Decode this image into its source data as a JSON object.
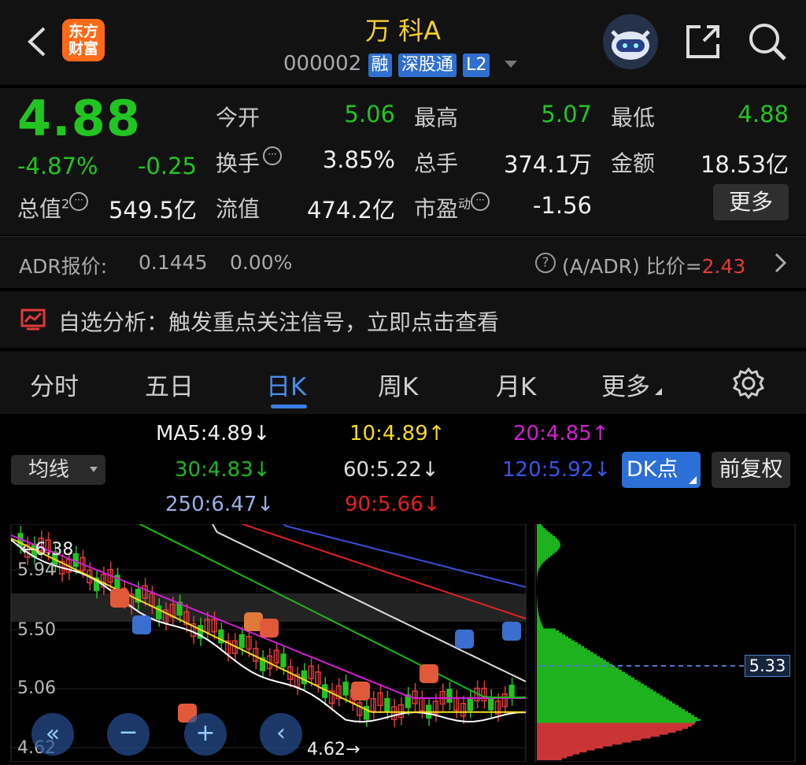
{
  "header": {
    "logo_top": "东方",
    "logo_bottom": "财富",
    "title": "万 科A",
    "code": "000002",
    "tags": [
      "融",
      "深股通",
      "L2"
    ]
  },
  "quote": {
    "price": "4.88",
    "change_pct": "-4.87%",
    "change": "-0.25",
    "total_value_label": "总值",
    "total_value_sup": "2",
    "total_value": "549.5亿",
    "open_label": "今开",
    "open": "5.06",
    "high_label": "最高",
    "high": "5.07",
    "low_label": "最低",
    "low": "4.88",
    "turnover_label": "换手",
    "turnover": "3.85%",
    "volume_label": "总手",
    "volume": "374.1万",
    "amount_label": "金额",
    "amount": "18.53亿",
    "float_label": "流值",
    "float_value": "474.2亿",
    "pe_label": "市盈",
    "pe_sup": "动",
    "pe": "-1.56",
    "more_label": "更多"
  },
  "adr": {
    "label": "ADR报价:",
    "price": "0.1445",
    "pct": "0.00%",
    "ratio_label": "(A/ADR) 比价=",
    "ratio": "2.43"
  },
  "signal": {
    "text": "自选分析：触发重点关注信号，立即点击查看"
  },
  "tabs": [
    "分时",
    "五日",
    "日K",
    "周K",
    "月K",
    "更多"
  ],
  "active_tab": "日K",
  "indicators": {
    "ma_select": "均线",
    "dk_button": "DK点",
    "fq_button": "前复权",
    "ma5": "MA5:4.89↓",
    "ma10": "10:4.89↑",
    "ma20": "20:4.85↑",
    "ma30": "30:4.83↓",
    "ma60": "60:5.22↓",
    "ma120": "120:5.92↓",
    "ma250": "250:6.47↓",
    "ma90": "90:5.66↓"
  },
  "chart_data": {
    "type": "candlestick",
    "y_ticks": [
      "5.94",
      "5.50",
      "5.06",
      "4.62"
    ],
    "high_marker": "6.38",
    "low_marker": "4.62",
    "profile_price": "5.33",
    "colors": {
      "up": "#e03a3a",
      "down": "#21c521",
      "ma5": "#ffffff",
      "ma10": "#f5d922",
      "ma20": "#d21fd2",
      "ma30": "#1fb51f",
      "ma60": "#dddddd",
      "ma90": "#e42020",
      "ma120": "#3a4fd6",
      "ma250": "#9ab0e6"
    }
  }
}
